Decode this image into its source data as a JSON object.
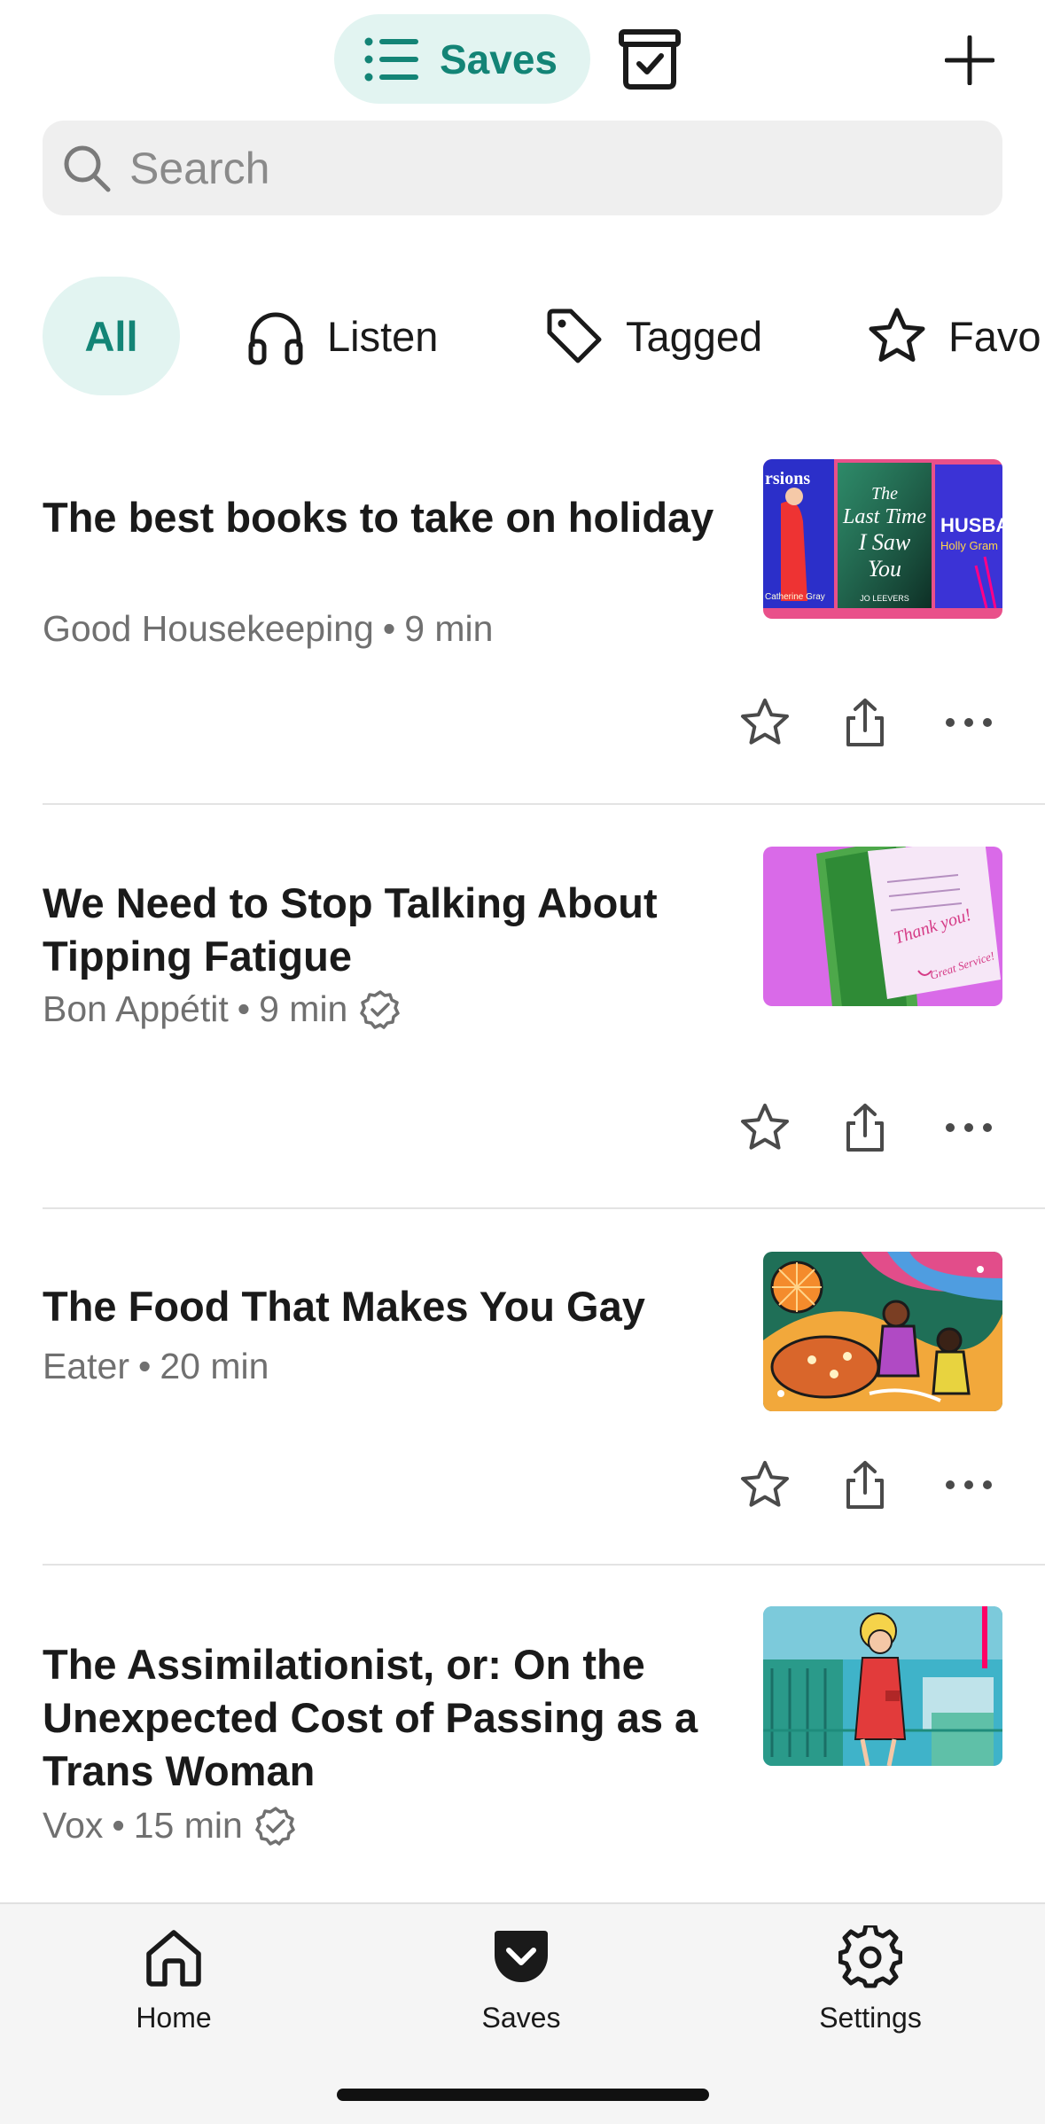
{
  "header": {
    "saves_label": "Saves",
    "icons": [
      "list-icon",
      "archive-icon",
      "plus-icon"
    ]
  },
  "search": {
    "placeholder": "Search",
    "value": ""
  },
  "filters": [
    {
      "label": "All",
      "active": true
    },
    {
      "label": "Listen",
      "icon": "headphones-icon"
    },
    {
      "label": "Tagged",
      "icon": "tag-icon"
    },
    {
      "label": "Favo",
      "icon": "star-icon"
    }
  ],
  "articles": [
    {
      "title": "The best books to take on holiday",
      "source": "Good Housekeeping",
      "read_time": "9 min",
      "verified": false,
      "thumbnail_text": [
        "rsions",
        "The Last Time I Saw You",
        "JO LEEVERS",
        "HUSBA",
        "Holly Gram",
        "Catherine Gray"
      ]
    },
    {
      "title": "We Need to Stop Talking About Tipping Fatigue",
      "source": "Bon Appétit",
      "read_time": "9 min",
      "verified": true,
      "thumbnail_text": [
        "Thank you!",
        "Great Service!"
      ]
    },
    {
      "title": "The Food That Makes You Gay",
      "source": "Eater",
      "read_time": "20 min",
      "verified": false
    },
    {
      "title": "The Assimilationist, or: On the Unexpected Cost of Passing as a Trans Woman",
      "source": "Vox",
      "read_time": "15 min",
      "verified": true
    }
  ],
  "meta_separator": "•",
  "bottom_nav": [
    {
      "label": "Home",
      "icon": "home-icon"
    },
    {
      "label": "Saves",
      "icon": "pocket-icon"
    },
    {
      "label": "Settings",
      "icon": "gear-icon"
    }
  ],
  "colors": {
    "accent": "#138476",
    "accent_bg": "#e2f4f1",
    "search_bg": "#efefef",
    "nav_bg": "#f5f5f5"
  }
}
